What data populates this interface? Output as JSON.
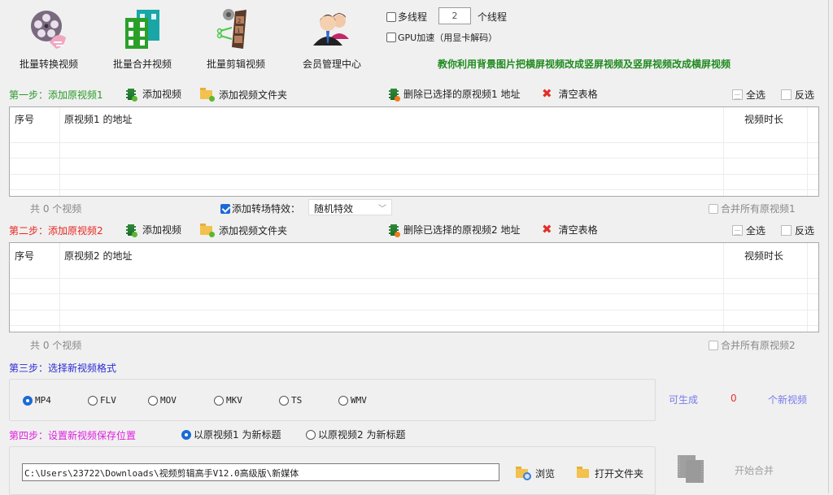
{
  "toolbar": {
    "buttons": [
      {
        "label": "批量转换视频",
        "icon": "film-reel-convert-icon"
      },
      {
        "label": "批量合并视频",
        "icon": "film-merge-icon"
      },
      {
        "label": "批量剪辑视频",
        "icon": "film-cut-icon"
      },
      {
        "label": "会员管理中心",
        "icon": "members-icon"
      }
    ],
    "multithread_label": "多线程",
    "multithread_checked": false,
    "thread_count": "2",
    "thread_suffix": "个线程",
    "gpu_label": "GPU加速（用显卡解码）",
    "gpu_checked": false,
    "tutorial_link": "教你利用背景图片把横屏视频改成竖屏视频及竖屏视频改成横屏视频"
  },
  "step1": {
    "title": "第一步：添加原视频1",
    "title_color": "#2a9a2a",
    "add_video": "添加视频",
    "add_folder": "添加视频文件夹",
    "delete_selected": "删除已选择的原视频1 地址",
    "clear_table": "清空表格",
    "select_all": "全选",
    "invert_select": "反选",
    "columns": [
      "序号",
      "原视频1 的地址",
      "视频时长"
    ],
    "rows": [],
    "count_text": "共 0 个视频",
    "merge_all_label": "合并所有原视频1",
    "merge_all_checked": false
  },
  "transition": {
    "label": "添加转场特效：",
    "checked": true,
    "selected": "随机特效"
  },
  "step2": {
    "title": "第二步：添加原视频2",
    "title_color": "#e8261f",
    "add_video": "添加视频",
    "add_folder": "添加视频文件夹",
    "delete_selected": "删除已选择的原视频2 地址",
    "clear_table": "清空表格",
    "select_all": "全选",
    "invert_select": "反选",
    "columns": [
      "序号",
      "原视频2 的地址",
      "视频时长"
    ],
    "rows": [],
    "count_text": "共 0 个视频",
    "merge_all_label": "合并所有原视频2",
    "merge_all_checked": false
  },
  "step3": {
    "title": "第三步：选择新视频格式",
    "title_color": "#2b2bd6",
    "formats": [
      "MP4",
      "FLV",
      "MOV",
      "MKV",
      "TS",
      "WMV"
    ],
    "selected_format": "MP4",
    "can_generate_label": "可生成",
    "can_generate_count": "0",
    "new_videos_label": "个新视频"
  },
  "step4": {
    "title": "第四步：设置新视频保存位置",
    "title_color": "#e020e0",
    "title_options": [
      "以原视频1 为新标题",
      "以原视频2 为新标题"
    ],
    "selected_title_option": 0,
    "save_path": "C:\\Users\\23722\\Downloads\\视频剪辑高手V12.0高级版\\新媒体",
    "browse": "浏览",
    "open_folder": "打开文件夹",
    "start_merge": "开始合并"
  }
}
